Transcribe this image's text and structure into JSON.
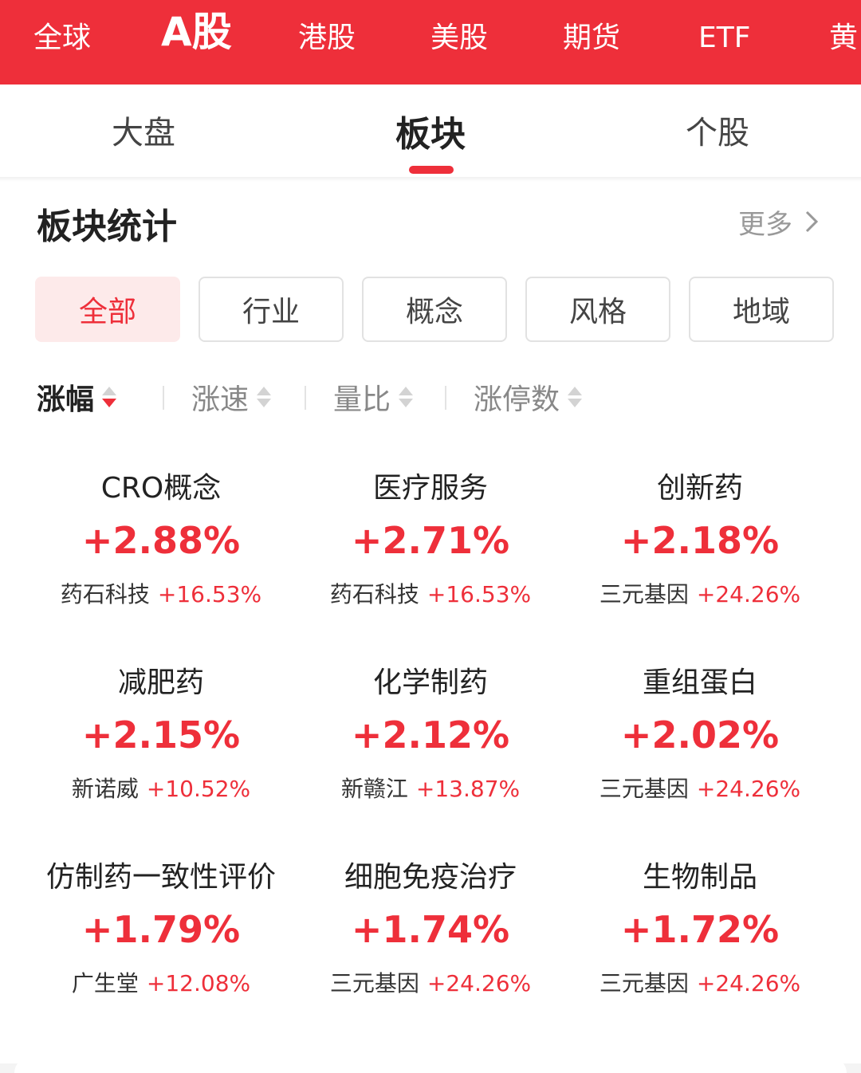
{
  "market_tabs": [
    "全球",
    "A股",
    "港股",
    "美股",
    "期货",
    "ETF",
    "黄"
  ],
  "active_market_tab": "A股",
  "sub_tabs": [
    "大盘",
    "板块",
    "个股"
  ],
  "active_sub_tab": "板块",
  "section": {
    "title": "板块统计",
    "more_label": "更多",
    "more_icon": "chevron-right-icon"
  },
  "filters": [
    "全部",
    "行业",
    "概念",
    "风格",
    "地域"
  ],
  "active_filter": "全部",
  "sorts": [
    "涨幅",
    "涨速",
    "量比",
    "涨停数"
  ],
  "active_sort": "涨幅",
  "sectors": [
    {
      "name": "CRO概念",
      "change": "+2.88%",
      "leader": "药石科技",
      "leader_change": "+16.53%"
    },
    {
      "name": "医疗服务",
      "change": "+2.71%",
      "leader": "药石科技",
      "leader_change": "+16.53%"
    },
    {
      "name": "创新药",
      "change": "+2.18%",
      "leader": "三元基因",
      "leader_change": "+24.26%"
    },
    {
      "name": "减肥药",
      "change": "+2.15%",
      "leader": "新诺威",
      "leader_change": "+10.52%"
    },
    {
      "name": "化学制药",
      "change": "+2.12%",
      "leader": "新赣江",
      "leader_change": "+13.87%"
    },
    {
      "name": "重组蛋白",
      "change": "+2.02%",
      "leader": "三元基因",
      "leader_change": "+24.26%"
    },
    {
      "name": "仿制药一致性评价",
      "change": "+1.79%",
      "leader": "广生堂",
      "leader_change": "+12.08%"
    },
    {
      "name": "细胞免疫治疗",
      "change": "+1.74%",
      "leader": "三元基因",
      "leader_change": "+24.26%"
    },
    {
      "name": "生物制品",
      "change": "+1.72%",
      "leader": "三元基因",
      "leader_change": "+24.26%"
    }
  ],
  "colors": {
    "accent": "#ee2f3a",
    "chip_active_bg": "#fdeaea",
    "text_primary": "#222222",
    "text_secondary": "#888888"
  }
}
